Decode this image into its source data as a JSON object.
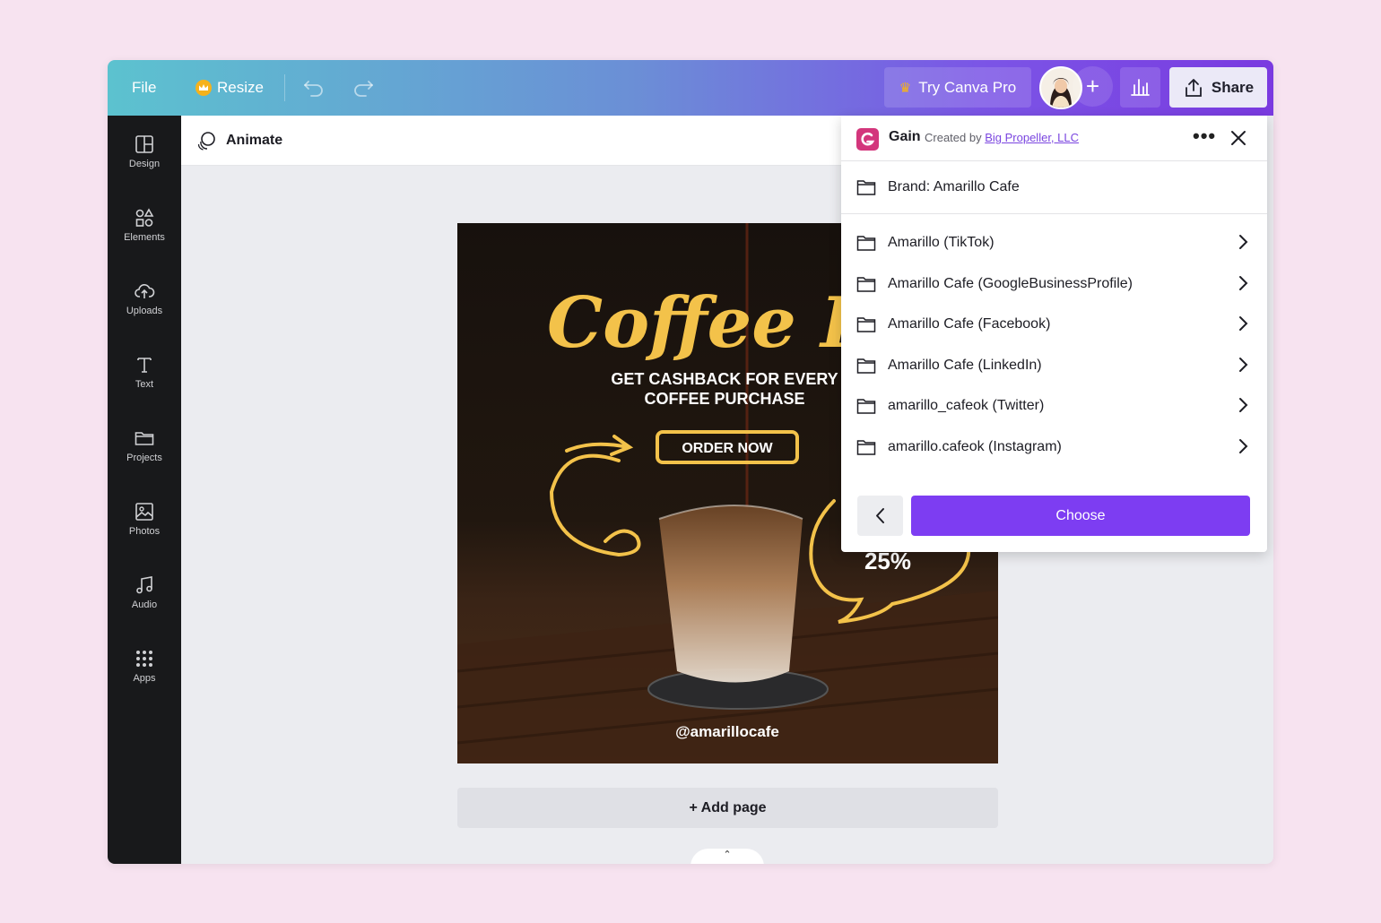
{
  "topbar": {
    "file_label": "File",
    "resize_label": "Resize",
    "try_pro_label": "Try Canva Pro",
    "share_label": "Share"
  },
  "sidebar": {
    "items": [
      {
        "label": "Design",
        "icon": "design-icon"
      },
      {
        "label": "Elements",
        "icon": "elements-icon"
      },
      {
        "label": "Uploads",
        "icon": "upload-cloud-icon"
      },
      {
        "label": "Text",
        "icon": "text-icon"
      },
      {
        "label": "Projects",
        "icon": "folder-icon"
      },
      {
        "label": "Photos",
        "icon": "photo-icon"
      },
      {
        "label": "Audio",
        "icon": "music-note-icon"
      },
      {
        "label": "Apps",
        "icon": "apps-grid-icon"
      }
    ]
  },
  "toolbar": {
    "animate_label": "Animate"
  },
  "design": {
    "headline": "Coffee Promo",
    "subhead_line1": "GET CASHBACK FOR EVERY",
    "subhead_line2": "COFFEE PURCHASE",
    "cta": "ORDER NOW",
    "discount": "25%",
    "handle": "@amarillocafe"
  },
  "canvas": {
    "add_page_label": "+ Add page",
    "collapse_glyph": "⌃"
  },
  "panel": {
    "app_name": "Gain",
    "created_by_prefix": "Created by",
    "creator": "Big Propeller, LLC",
    "brand_label": "Brand: Amarillo Cafe",
    "folders": [
      "Amarillo (TikTok)",
      "Amarillo Cafe (GoogleBusinessProfile)",
      "Amarillo Cafe (Facebook)",
      "Amarillo Cafe (LinkedIn)",
      "amarillo_cafeok (Twitter)",
      "amarillo.cafeok (Instagram)"
    ],
    "choose_label": "Choose"
  },
  "colors": {
    "accent": "#7d3df2",
    "design_yellow": "#f3c24a",
    "link": "#7a45e0"
  }
}
